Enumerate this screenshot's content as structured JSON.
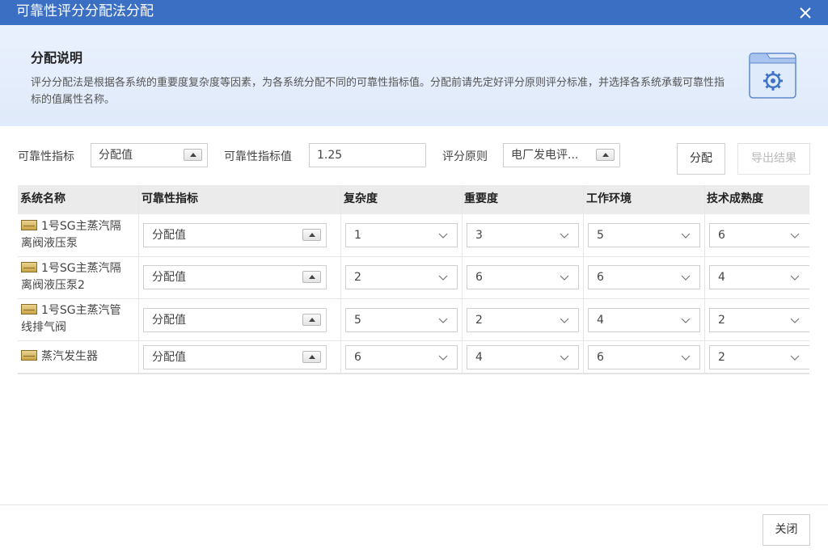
{
  "dialog": {
    "title": "可靠性评分分配法分配",
    "close_icon": "close-icon"
  },
  "banner": {
    "heading": "分配说明",
    "description": "评分分配法是根据各系统的重要度复杂度等因素，为各系统分配不同的可靠性指标值。分配前请先定好评分原则评分标准，并选择各系统承载可靠性指标的值属性名称。",
    "icon": "settings-window-icon"
  },
  "filters": {
    "indicator_label": "可靠性指标",
    "indicator_value": "分配值",
    "indicator_value_label": "可靠性指标值",
    "indicator_value_input": "1.25",
    "scoring_principle_label": "评分原则",
    "scoring_principle_value": "电厂发电评..."
  },
  "buttons": {
    "allocate": "分配",
    "export": "导出结果",
    "close": "关闭"
  },
  "table": {
    "headers": [
      "系统名称",
      "可靠性指标",
      "复杂度",
      "重要度",
      "工作环境",
      "技术成熟度"
    ],
    "rows": [
      {
        "name_line1": "1号SG主蒸汽隔",
        "name_line2": "离阀液压泵",
        "indicator": "分配值",
        "complexity": "1",
        "importance": "3",
        "environment": "5",
        "maturity": "6"
      },
      {
        "name_line1": "1号SG主蒸汽隔",
        "name_line2": "离阀液压泵2",
        "indicator": "分配值",
        "complexity": "2",
        "importance": "6",
        "environment": "6",
        "maturity": "4"
      },
      {
        "name_line1": "1号SG主蒸汽管",
        "name_line2": "线排气阀",
        "indicator": "分配值",
        "complexity": "5",
        "importance": "2",
        "environment": "4",
        "maturity": "2"
      },
      {
        "name_line1": "蒸汽发生器",
        "name_line2": "",
        "indicator": "分配值",
        "complexity": "6",
        "importance": "4",
        "environment": "6",
        "maturity": "2"
      }
    ]
  },
  "colors": {
    "titlebar": "#3a6fc4",
    "banner": "#e4edfb",
    "table_header": "#ebebeb"
  }
}
